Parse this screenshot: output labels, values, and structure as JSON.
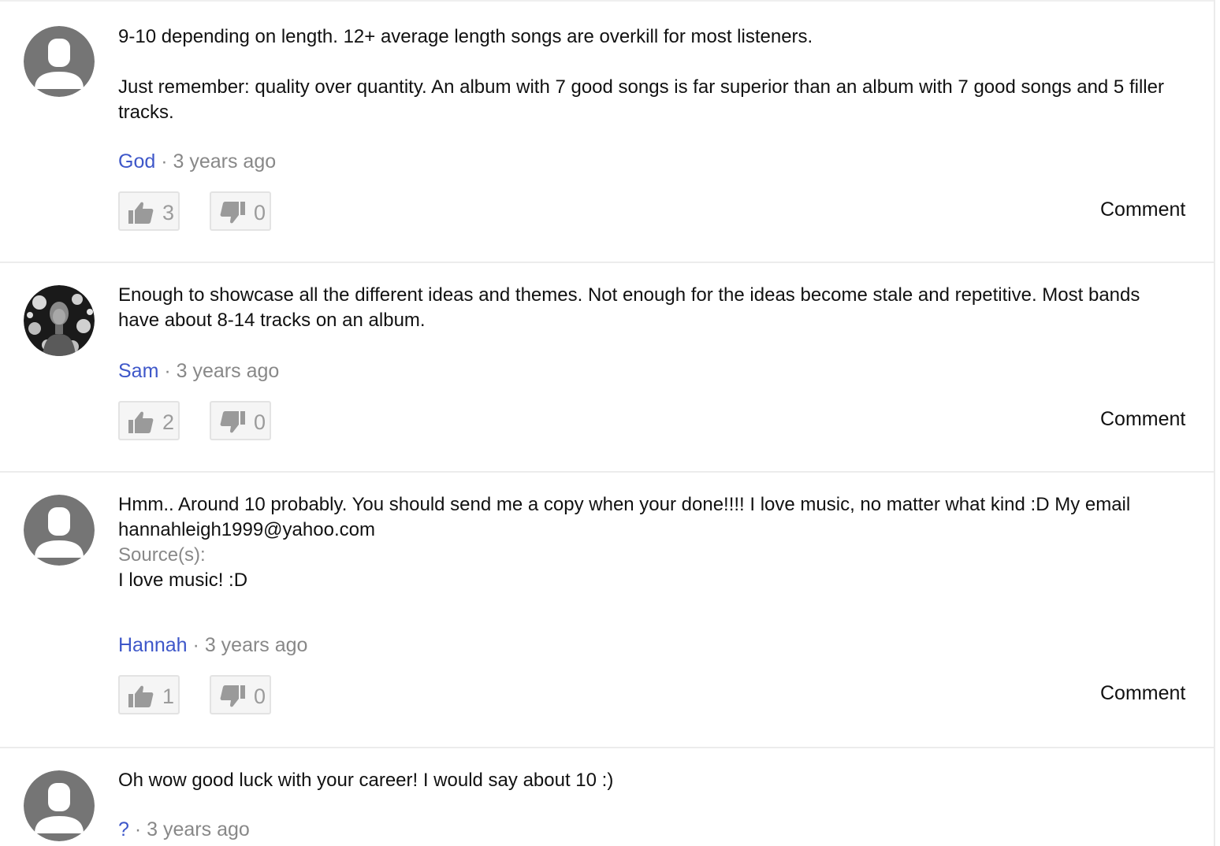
{
  "answers": [
    {
      "avatar": "default-user-icon",
      "paragraphs": [
        "9-10 depending on length. 12+ average length songs are overkill for most listeners.",
        "Just remember: quality over quantity. An album with 7 good songs is far superior than an album with 7 good songs and 5 filler tracks."
      ],
      "author": "God",
      "separator": "·",
      "time": "3 years ago",
      "likes": "3",
      "dislikes": "0",
      "comment_label": "Comment"
    },
    {
      "avatar": "user-photo",
      "paragraphs": [
        "Enough to showcase all the different ideas and themes. Not enough for the ideas become stale and repetitive. Most bands have about 8-14 tracks on an album."
      ],
      "author": "Sam",
      "separator": "·",
      "time": "3 years ago",
      "likes": "2",
      "dislikes": "0",
      "comment_label": "Comment"
    },
    {
      "avatar": "default-user-icon",
      "paragraphs": [
        "Hmm.. Around 10 probably. You should send me a copy when your done!!!! I love music, no matter what kind :D My email hannahleigh1999@yahoo.com"
      ],
      "source_label": "Source(s):",
      "source_text": "I love music! :D",
      "author": "Hannah",
      "separator": "·",
      "time": "3 years ago",
      "likes": "1",
      "dislikes": "0",
      "comment_label": "Comment"
    },
    {
      "avatar": "default-user-icon",
      "paragraphs": [
        "Oh wow good luck with your career! I would say about 10 :)"
      ],
      "author": "?",
      "separator": "·",
      "time": "3 years ago"
    }
  ],
  "colors": {
    "author_link": "#3e57c9",
    "meta_gray": "#888888",
    "avatar_bg": "#757575",
    "vote_icon": "#9a9a9a"
  }
}
